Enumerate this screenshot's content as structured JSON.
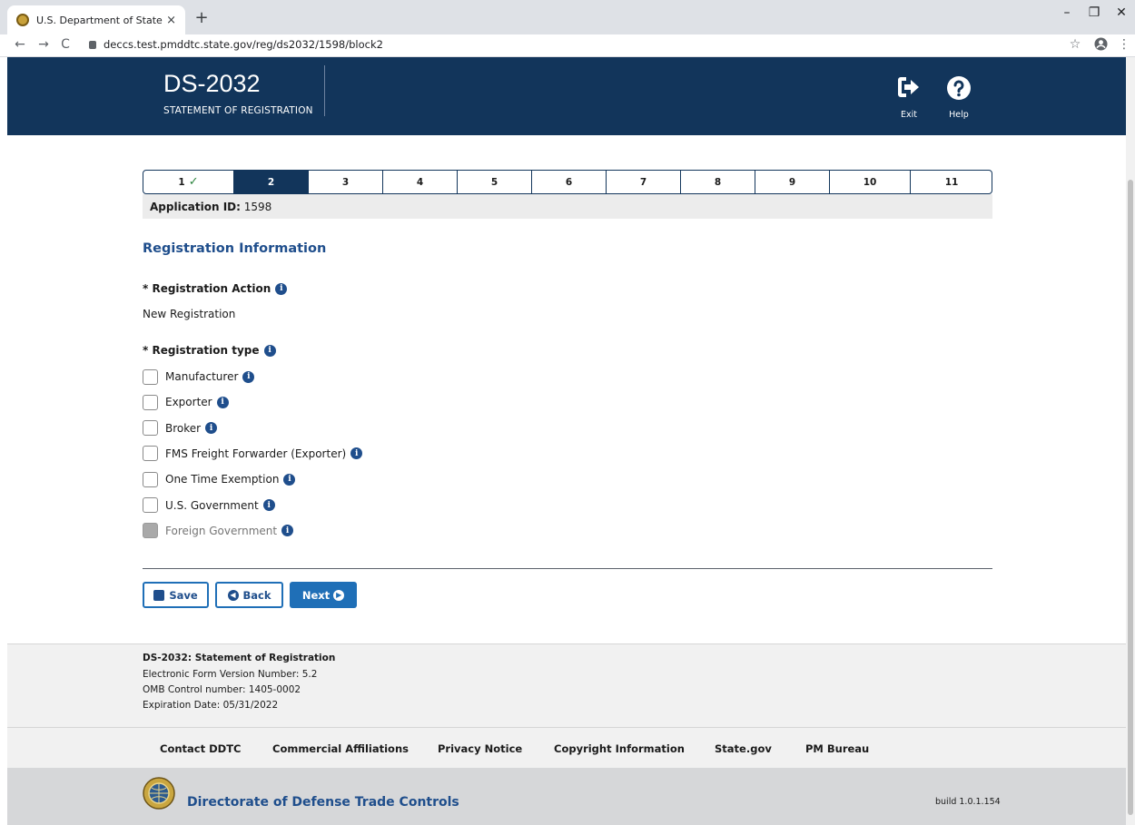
{
  "browser": {
    "tab_title": "U.S. Department of State Directo",
    "tab_close": "×",
    "new_tab": "+",
    "url": "deccs.test.pmddtc.state.gov/reg/ds2032/1598/block2",
    "back": "←",
    "forward": "→",
    "reload": "C",
    "bookmark": "☆",
    "menu": "⋮",
    "minimize": "–",
    "maximize": "❐",
    "close": "✕"
  },
  "header": {
    "form_code": "DS-2032",
    "form_subtitle": "STATEMENT OF REGISTRATION",
    "exit_label": "Exit",
    "help_label": "Help"
  },
  "stepper": {
    "steps": [
      {
        "label": "1",
        "state": "complete"
      },
      {
        "label": "2",
        "state": "active"
      },
      {
        "label": "3",
        "state": "pending"
      },
      {
        "label": "4",
        "state": "pending"
      },
      {
        "label": "5",
        "state": "pending"
      },
      {
        "label": "6",
        "state": "pending"
      },
      {
        "label": "7",
        "state": "pending"
      },
      {
        "label": "8",
        "state": "pending"
      },
      {
        "label": "9",
        "state": "pending"
      },
      {
        "label": "10",
        "state": "pending"
      },
      {
        "label": "11",
        "state": "pending"
      }
    ],
    "check": "✓"
  },
  "application": {
    "id_label": "Application ID:",
    "id_value": "1598"
  },
  "form": {
    "section_title": "Registration Information",
    "action_label": "* Registration Action",
    "action_value": "New Registration",
    "type_label": "* Registration type",
    "info_glyph": "i",
    "options": [
      {
        "label": "Manufacturer",
        "checked": false,
        "disabled": false
      },
      {
        "label": "Exporter",
        "checked": false,
        "disabled": false
      },
      {
        "label": "Broker",
        "checked": false,
        "disabled": false
      },
      {
        "label": "FMS Freight Forwarder (Exporter)",
        "checked": false,
        "disabled": false
      },
      {
        "label": "One Time Exemption",
        "checked": false,
        "disabled": false
      },
      {
        "label": "U.S. Government",
        "checked": false,
        "disabled": false
      },
      {
        "label": "Foreign Government",
        "checked": false,
        "disabled": true
      }
    ]
  },
  "actions": {
    "save_label": "Save",
    "back_label": "Back",
    "next_label": "Next"
  },
  "footer": {
    "title": "DS-2032: Statement of Registration",
    "version": "Electronic Form Version Number: 5.2",
    "omb": "OMB Control number: 1405-0002",
    "expiration": "Expiration Date: 05/31/2022",
    "links": [
      "Contact DDTC",
      "Commercial Affiliations",
      "Privacy Notice",
      "Copyright Information",
      "State.gov",
      "PM Bureau"
    ],
    "org_name": "Directorate of Defense Trade Controls",
    "build": "build 1.0.1.154"
  },
  "colors": {
    "header_bg": "#12355b",
    "accent": "#1f6fb7",
    "link_blue": "#1f4e8c",
    "success": "#2e8540"
  }
}
